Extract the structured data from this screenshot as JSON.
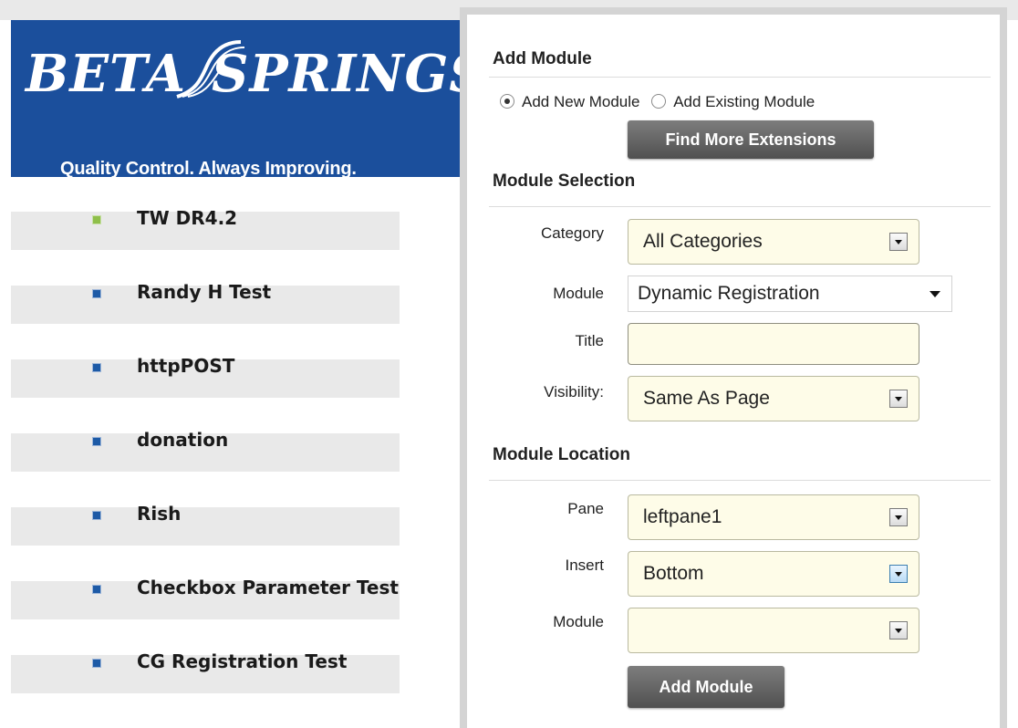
{
  "brand": {
    "logo_text": "BETA SPRINGS",
    "tagline": "Quality Control. Always Improving.",
    "colors": {
      "header_bg": "#1b4f9c",
      "bullet": "#1d5aa6",
      "active_bullet": "#8fbf4a"
    }
  },
  "nav": {
    "items": [
      {
        "label": "TW DR4.2",
        "active": true
      },
      {
        "label": "Randy H Test"
      },
      {
        "label": "httpPOST"
      },
      {
        "label": "donation"
      },
      {
        "label": "Rish"
      },
      {
        "label": "Checkbox Parameter Test"
      },
      {
        "label": "CG Registration Test"
      }
    ]
  },
  "panel": {
    "add_module": {
      "title": "Add Module",
      "radio_new": "Add New Module",
      "radio_existing": "Add Existing Module",
      "selected": "Add New Module",
      "find_button": "Find More Extensions"
    },
    "selection": {
      "title": "Module Selection",
      "category_label": "Category",
      "category_value": "All Categories",
      "module_label": "Module",
      "module_value": "Dynamic Registration",
      "title_label": "Title",
      "title_value": "",
      "visibility_label": "Visibility:",
      "visibility_value": "Same As Page"
    },
    "location": {
      "title": "Module Location",
      "pane_label": "Pane",
      "pane_value": "leftpane1",
      "insert_label": "Insert",
      "insert_value": "Bottom",
      "module_label": "Module",
      "module_value": "",
      "add_button": "Add Module"
    }
  }
}
